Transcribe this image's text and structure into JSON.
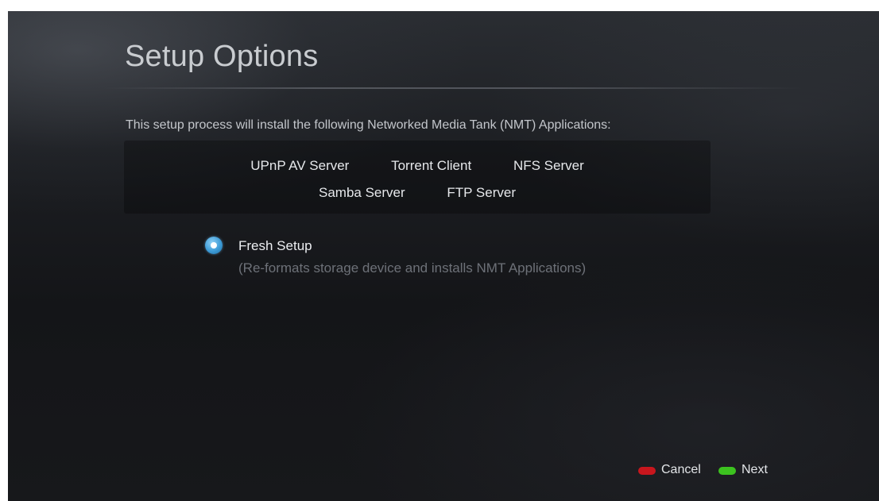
{
  "page": {
    "title": "Setup Options",
    "intro": "This setup process will install the following Networked Media Tank (NMT) Applications:"
  },
  "applications": {
    "row1": [
      "UPnP AV Server",
      "Torrent Client",
      "NFS Server"
    ],
    "row2": [
      "Samba Server",
      "FTP Server"
    ]
  },
  "option": {
    "label": "Fresh Setup",
    "description": "(Re-formats storage device and installs NMT Applications)",
    "selected": true,
    "accent_color": "#3d9bd6"
  },
  "footer": {
    "cancel": {
      "label": "Cancel",
      "key_color": "#c8161d"
    },
    "next": {
      "label": "Next",
      "key_color": "#3cc21f"
    }
  }
}
